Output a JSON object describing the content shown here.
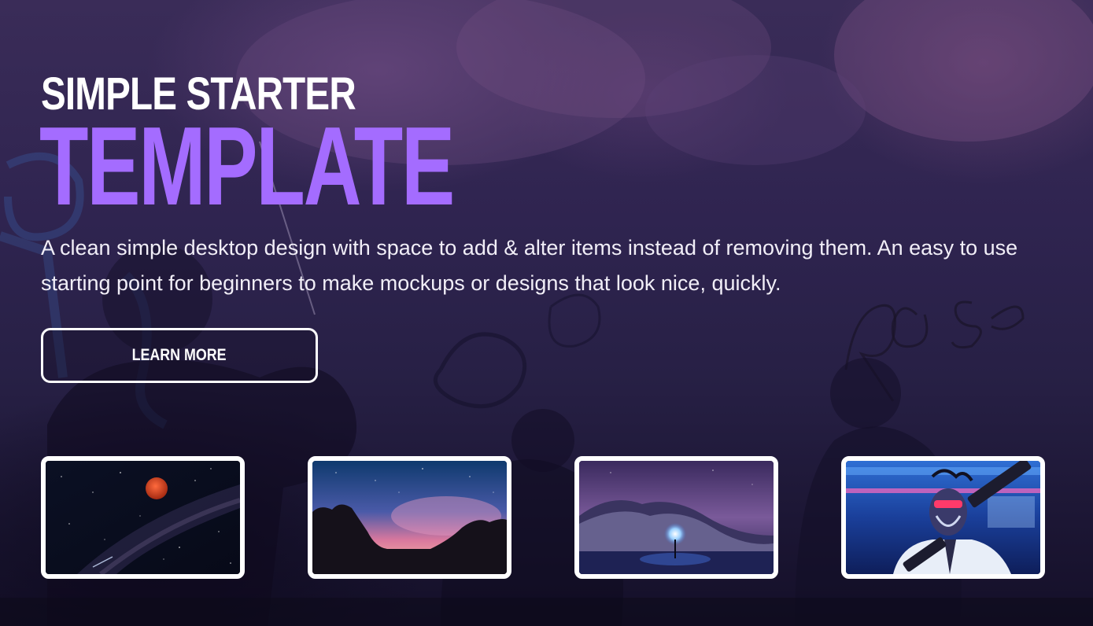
{
  "hero": {
    "title_line1": "SIMPLE STARTER",
    "title_line2": "TEMPLATE",
    "description": "A clean simple desktop design with space to add & alter items instead of removing them. An easy to use starting point for beginners to make mockups or designs that look nice, quickly.",
    "button_label": "LEARN MORE"
  },
  "gallery": [
    {
      "name": "blood-moon-milky-way-image"
    },
    {
      "name": "pink-sunset-rock-silhouette-image"
    },
    {
      "name": "night-mountain-light-orb-image"
    },
    {
      "name": "neon-robot-figure-image"
    }
  ],
  "colors": {
    "accent": "#a46cff",
    "text": "#ffffff",
    "background": "#2a2148"
  }
}
